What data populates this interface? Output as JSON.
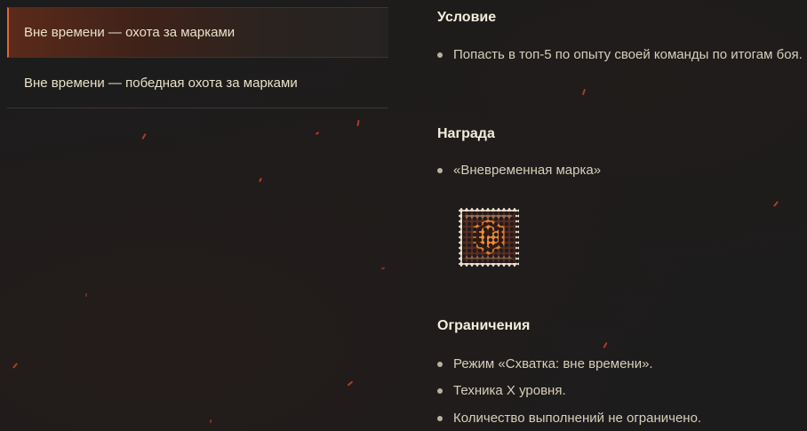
{
  "nav": {
    "items": [
      {
        "label": "Вне времени — охота за марками",
        "active": true
      },
      {
        "label": "Вне времени — победная охота за марками",
        "active": false
      }
    ]
  },
  "sections": {
    "condition": {
      "title": "Условие",
      "items": [
        "Попасть в топ-5 по опыту своей команды по итогам боя."
      ]
    },
    "reward": {
      "title": "Награда",
      "items": [
        "«Вневременная марка»"
      ],
      "image_icon": "timeless-stamp-icon"
    },
    "restrictions": {
      "title": "Ограничения",
      "items": [
        "Режим «Схватка: вне времени».",
        "Техника X уровня.",
        "Количество выполнений не ограничено."
      ]
    }
  },
  "colors": {
    "background": "#1c1c1c",
    "accent": "#e0673a",
    "heading": "#f3eedb",
    "text": "#d6cfba"
  }
}
